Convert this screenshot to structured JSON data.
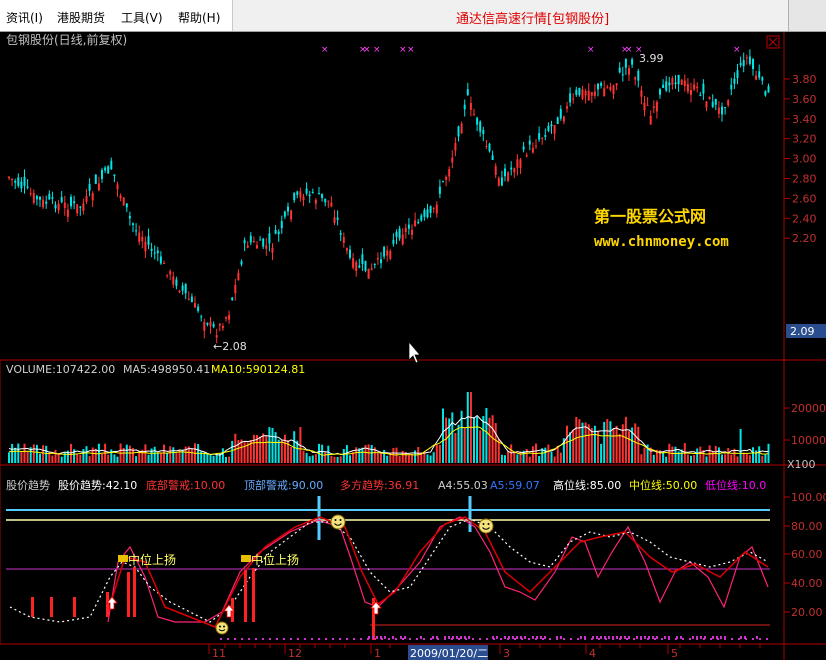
{
  "menu": {
    "items": [
      "资讯(I)",
      "港股期货",
      "工具(V)",
      "帮助(H)"
    ],
    "title": "通达信高速行情[包钢股份]"
  },
  "stock": {
    "name": "包钢股份(日线,前复权)",
    "current_price": "2.09",
    "high_label": "3.99",
    "low_label": "←2.08"
  },
  "watermark": {
    "line1": "第一股票公式网",
    "line2": "www.chnmoney.com"
  },
  "price_axis": [
    "3.80",
    "3.60",
    "3.40",
    "3.20",
    "3.00",
    "2.80",
    "2.60",
    "2.40",
    "2.20"
  ],
  "volume": {
    "label": "VOLUME:107422.00",
    "ma5": "MA5:498950.41",
    "ma10": "MA10:590124.81",
    "axis": [
      "20000",
      "10000"
    ],
    "unit": "X100"
  },
  "indicator": {
    "name": "股价趋势",
    "value": "股价趋势:42.10",
    "bottom_warning": "底部警戒:10.00",
    "top_warning": "顶部警戒:90.00",
    "multi_trend": "多方趋势:36.91",
    "a4": "A4:55.03",
    "a5": "A5:59.07",
    "high_line": "高位线:85.00",
    "mid_line": "中位线:50.00",
    "low_line": "低位线:10.0",
    "axis": [
      "100.00",
      "80.00",
      "60.00",
      "40.00",
      "20.00"
    ],
    "annotation": "中位上扬"
  },
  "date_axis": {
    "labels": [
      "11",
      "12",
      "1",
      "3",
      "4",
      "5"
    ],
    "cursor_date": "2009/01/20/二"
  },
  "colors": {
    "up": "#ff3333",
    "down": "#00e5e5",
    "grid": "#b00000",
    "yellow": "#ffff00",
    "magenta": "#ff00ff",
    "cyan": "#66ccff",
    "watermark": "#ffd700"
  }
}
